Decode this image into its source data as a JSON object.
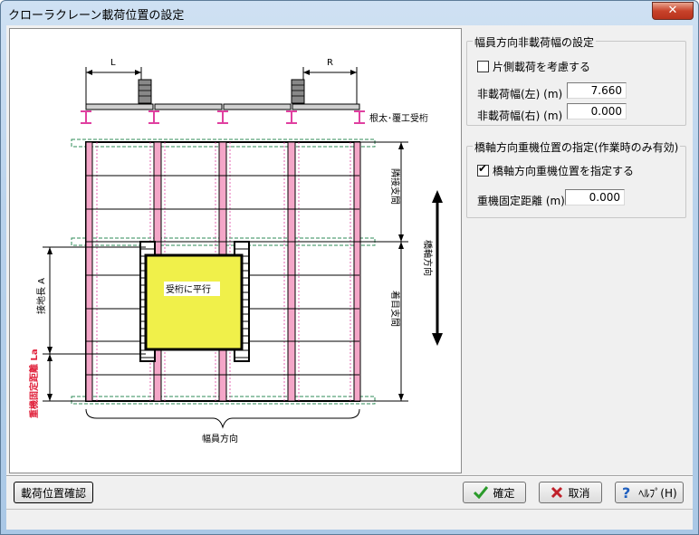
{
  "window": {
    "title": "クローラクレーン載荷位置の設定",
    "close_label": "✕"
  },
  "diagram": {
    "label_L": "L",
    "label_R": "R",
    "label_girders": "根太･覆工受桁",
    "label_inner_span": "受桁に平行",
    "label_span_upper": "隣接支間",
    "label_span_lower": "着目支間",
    "label_bridge_axis": "橋軸方向",
    "label_contact_length": "接地長 A",
    "label_fixed_distance": "重機固定距離 La",
    "label_width_direction": "幅員方向"
  },
  "width_group": {
    "title": "幅員方向非載荷幅の設定",
    "one_side_label": "片側載荷を考慮する",
    "one_side_checked": false,
    "left_label": "非載荷幅(左) (m)",
    "left_value": "7.660",
    "right_label": "非載荷幅(右) (m)",
    "right_value": "0.000"
  },
  "axis_group": {
    "title": "橋軸方向重機位置の指定(作業時のみ有効)",
    "specify_label": "橋軸方向重機位置を指定する",
    "specify_checked": true,
    "distance_label": "重機固定距離 (m)",
    "distance_value": "0.000"
  },
  "buttons": {
    "check_position": "載荷位置確認",
    "ok": "確定",
    "cancel": "取消",
    "help": "ﾍﾙﾌﾟ(H)"
  }
}
